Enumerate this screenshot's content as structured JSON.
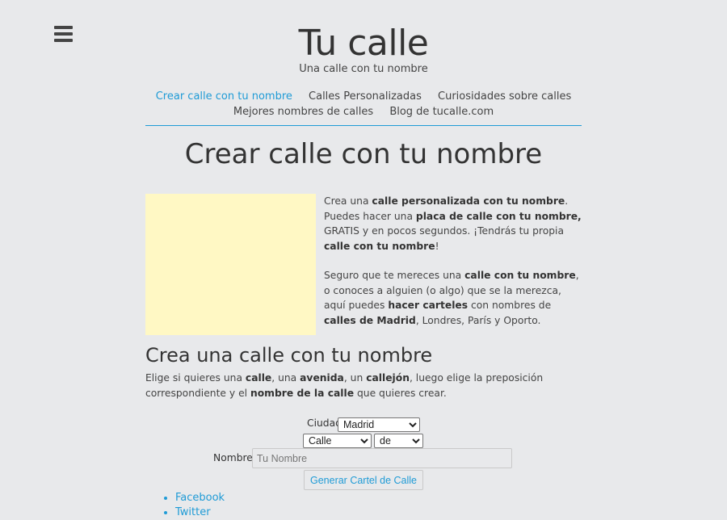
{
  "header": {
    "site_title": "Tu calle",
    "tagline": "Una calle con tu nombre"
  },
  "nav": {
    "items": [
      {
        "label": "Crear calle con tu nombre",
        "active": true
      },
      {
        "label": "Calles Personalizadas"
      },
      {
        "label": "Curiosidades sobre calles"
      },
      {
        "label": "Mejores nombres de calles"
      },
      {
        "label": "Blog de tucalle.com"
      }
    ]
  },
  "main": {
    "page_title": "Crear calle con tu nombre",
    "intro": {
      "p1": {
        "a": "Crea una ",
        "b": "calle personalizada con tu nombre",
        "c": ". Puedes hacer una ",
        "d": "placa de calle con tu nombre,",
        "e": " GRATIS y en pocos segundos. ¡Tendrás tu propia ",
        "f": "calle con tu nombre",
        "g": "!"
      },
      "p2": {
        "a": "Seguro que te mereces una ",
        "b": "calle con tu nombre",
        "c": ", o conoces a alguien (o algo) que se la merezca, aquí puedes ",
        "d": "hacer carteles",
        "e": " con nombres de ",
        "f": "calles de Madrid",
        "g": ", Londres, París y Oporto."
      }
    },
    "section_title": "Crea una calle con tu nombre",
    "section_desc": {
      "a": "Elige si quieres una ",
      "b": "calle",
      "c": ", una ",
      "d": "avenida",
      "e": ", un ",
      "f": "callejón",
      "g": ", luego elige la preposición correspondiente y el ",
      "h": "nombre de la calle",
      "i": " que quieres crear."
    }
  },
  "form": {
    "city_label": "Ciudad",
    "city_value": "Madrid",
    "type_value": "Calle",
    "prep_value": "de",
    "name_label": "Nombre",
    "name_placeholder": "Tu Nombre",
    "submit_label": "Generar Cartel de Calle"
  },
  "social": {
    "items": [
      "Facebook",
      "Twitter"
    ]
  },
  "colors": {
    "accent": "#1f9bd6",
    "background": "#e8e9eb",
    "ad_box": "#fff8c4"
  }
}
